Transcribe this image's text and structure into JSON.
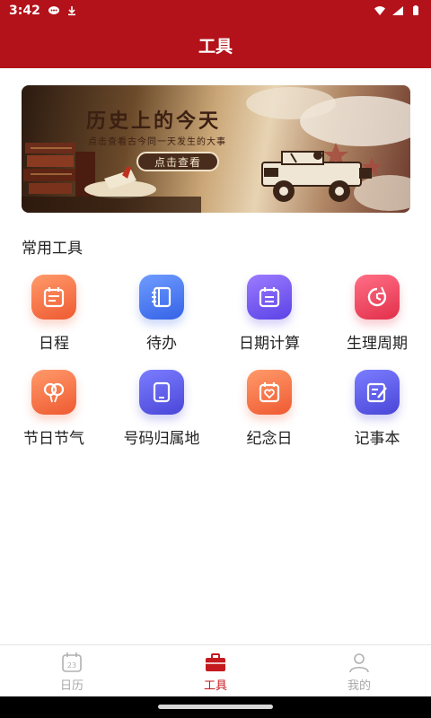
{
  "status_bar": {
    "time": "3:42"
  },
  "header": {
    "title": "工具"
  },
  "banner": {
    "title": "历史上的今天",
    "subtitle": "点击查看古今同一天发生的大事",
    "button_label": "点击查看"
  },
  "section": {
    "title": "常用工具"
  },
  "tools": [
    {
      "label": "日程",
      "icon": "calendar-icon",
      "color": "#ef5a32"
    },
    {
      "label": "待办",
      "icon": "notebook-icon",
      "color": "#3563e6"
    },
    {
      "label": "日期计算",
      "icon": "calendar-calc-icon",
      "color": "#5b43e6"
    },
    {
      "label": "生理周期",
      "icon": "cycle-clock-icon",
      "color": "#e2304b"
    },
    {
      "label": "节日节气",
      "icon": "balloons-icon",
      "color": "#ef5a32"
    },
    {
      "label": "号码归属地",
      "icon": "tablet-icon",
      "color": "#4a46d8"
    },
    {
      "label": "纪念日",
      "icon": "heart-calendar-icon",
      "color": "#ef5a32"
    },
    {
      "label": "记事本",
      "icon": "note-edit-icon",
      "color": "#4a46d8"
    }
  ],
  "bottom_nav": {
    "items": [
      {
        "label": "日历",
        "icon": "calendar-icon",
        "badge": "23"
      },
      {
        "label": "工具",
        "icon": "toolbox-icon",
        "active": true
      },
      {
        "label": "我的",
        "icon": "user-icon"
      }
    ]
  },
  "colors": {
    "brand": "#b3121a",
    "active_tab": "#c41a1f"
  }
}
